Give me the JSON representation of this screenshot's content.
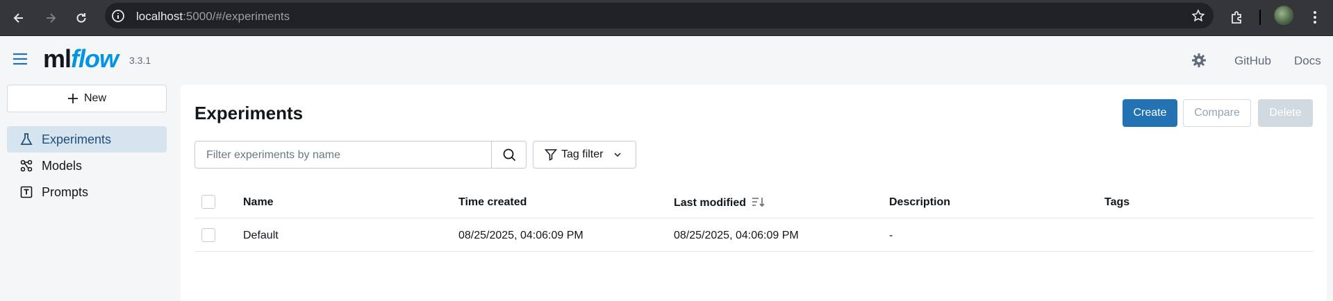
{
  "browser": {
    "url_host": "localhost",
    "url_rest": ":5000/#/experiments"
  },
  "header": {
    "logo_ml": "ml",
    "logo_flow": "flow",
    "version": "3.3.1",
    "links": [
      "GitHub",
      "Docs"
    ]
  },
  "sidebar": {
    "new_label": "New",
    "items": [
      {
        "label": "Experiments",
        "icon": "beaker-icon",
        "active": true
      },
      {
        "label": "Models",
        "icon": "models-icon",
        "active": false
      },
      {
        "label": "Prompts",
        "icon": "prompt-icon",
        "active": false
      }
    ]
  },
  "main": {
    "title": "Experiments",
    "buttons": {
      "create": "Create",
      "compare": "Compare",
      "delete": "Delete"
    },
    "search_placeholder": "Filter experiments by name",
    "tag_filter": "Tag filter",
    "columns": [
      "Name",
      "Time created",
      "Last modified",
      "Description",
      "Tags"
    ],
    "rows": [
      {
        "name": "Default",
        "time_created": "08/25/2025, 04:06:09 PM",
        "last_modified": "08/25/2025, 04:06:09 PM",
        "description": "-",
        "tags": ""
      }
    ]
  },
  "colors": {
    "accent": "#2272b4",
    "logo_blue": "#0194e2",
    "active_nav_bg": "#d6e4f0"
  }
}
